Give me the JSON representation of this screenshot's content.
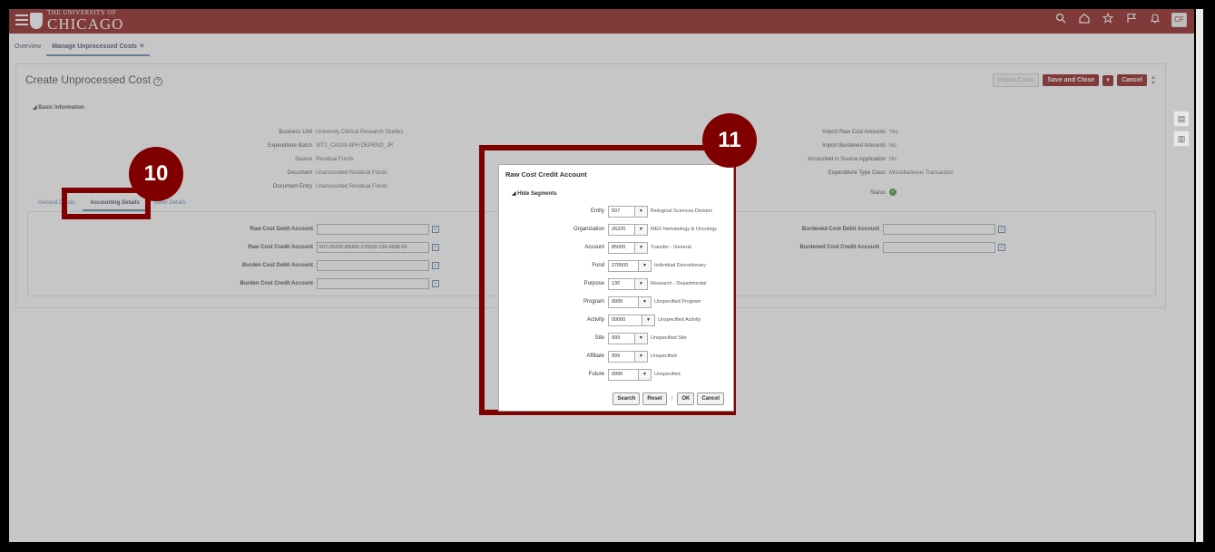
{
  "header": {
    "logo_small": "THE UNIVERSITY OF",
    "logo_big": "CHICAGO",
    "avatar": "CF",
    "icons": [
      "search-icon",
      "home-icon",
      "star-icon",
      "flag-icon",
      "bell-icon"
    ]
  },
  "tabs": {
    "overview": "Overview",
    "manage": "Manage Unprocessed Costs",
    "close": "×"
  },
  "page": {
    "title": "Create Unprocessed Cost",
    "import_costs": "Import Costs",
    "save_close": "Save and Close",
    "cancel": "Cancel",
    "section": "Basic Information"
  },
  "basic_left": [
    {
      "label": "Business Unit",
      "value": "University Clinical Research Studies"
    },
    {
      "label": "Expenditure Batch",
      "value": "SIT2_CA209-8PH DEPEND_JR"
    },
    {
      "label": "Source",
      "value": "Residual Funds"
    },
    {
      "label": "Document",
      "value": "Unaccounted Residual Funds"
    },
    {
      "label": "Document Entry",
      "value": "Unaccounted Residual Funds"
    }
  ],
  "basic_right": [
    {
      "label": "Import Raw Cost Amounts",
      "value": "Yes"
    },
    {
      "label": "Import Burdened Amounts",
      "value": "No"
    },
    {
      "label": "Accounted in Source Application",
      "value": "No"
    },
    {
      "label": "Expenditure Type Class",
      "value": "Miscellaneous Transaction"
    },
    {
      "label": "Status",
      "value": ""
    }
  ],
  "subtabs": {
    "general": "General Details",
    "accounting": "Accounting Details",
    "other": "Other Details"
  },
  "accounts_left": [
    {
      "label": "Raw Cost Debit Account",
      "value": ""
    },
    {
      "label": "Raw Cost Credit Account",
      "value": "507-26220-85000-270500-130-9999-99"
    },
    {
      "label": "Burden Cost Debit Account",
      "value": ""
    },
    {
      "label": "Burden Cost Credit Account",
      "value": ""
    }
  ],
  "accounts_right": [
    {
      "label": "Burdened Cost Debit Account",
      "value": ""
    },
    {
      "label": "Burdened Cost Credit Account",
      "value": ""
    }
  ],
  "callouts": {
    "ten": "10",
    "eleven": "11"
  },
  "dialog": {
    "title": "Raw Cost Credit Account",
    "hide_segments": "Hide Segments",
    "segments": [
      {
        "label": "Entity",
        "value": "507",
        "desc": "Biological Sciences Division"
      },
      {
        "label": "Organization",
        "value": "26220",
        "desc": "MED Hematology & Oncology"
      },
      {
        "label": "Account",
        "value": "85000",
        "desc": "Transfer - General"
      },
      {
        "label": "Fund",
        "value": "270500",
        "desc": "Individual Discretionary"
      },
      {
        "label": "Purpose",
        "value": "130",
        "desc": "Research - Departmental"
      },
      {
        "label": "Program",
        "value": "9999",
        "desc": "Unspecified Program"
      },
      {
        "label": "Activity",
        "value": "00000",
        "desc": "Unspecified Activity"
      },
      {
        "label": "Site",
        "value": "999",
        "desc": "Unspecified Site"
      },
      {
        "label": "Affiliate",
        "value": "999",
        "desc": "Unspecified"
      },
      {
        "label": "Future",
        "value": "9999",
        "desc": "Unspecified"
      }
    ],
    "search": "Search",
    "reset": "Reset",
    "ok": "OK",
    "cancel": "Cancel"
  }
}
